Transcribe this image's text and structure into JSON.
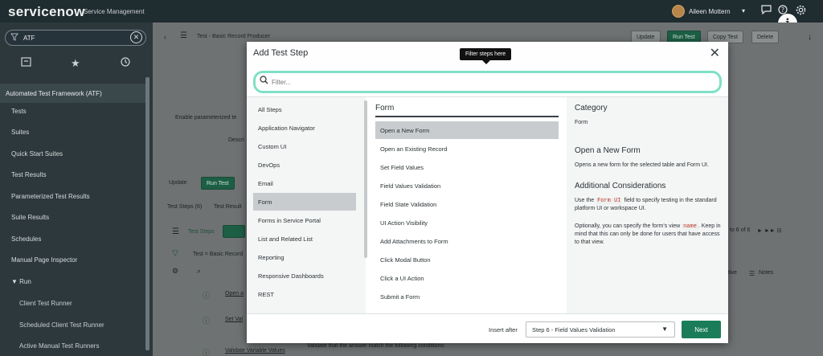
{
  "topbar": {
    "logo": "servicenow",
    "logo_sub": "Service Management",
    "user_name": "Aileen Mottern",
    "caret": "▾",
    "chat_icon": "chat-icon",
    "help_icon": "help-icon",
    "settings_icon": "gear-icon",
    "info_badge": "i"
  },
  "sidebar": {
    "filter_value": "ATF",
    "tabs": [
      "all-apps-icon",
      "star-icon",
      "history-icon"
    ],
    "module_title": "Automated Test Framework (ATF)",
    "items": [
      "Tests",
      "Suites",
      "Quick Start Suites",
      "Test Results",
      "Parameterized Test Results",
      "Suite Results",
      "Schedules",
      "Manual Page Inspector",
      "▼ Run"
    ],
    "sub_items": [
      "Client Test Runner",
      "Scheduled Client Test Runner",
      "Active Manual Test Runners"
    ]
  },
  "page": {
    "breadcrumb": "Test - Basic Record Producer",
    "header_buttons": [
      "Update",
      "Run Test",
      "Copy Test",
      "Delete"
    ],
    "form_labels": [
      "Enable parameterized te",
      "Descri"
    ],
    "action_buttons": [
      "Update",
      "Run Test"
    ],
    "related_tabs": [
      "Test Steps (6)",
      "Test Result"
    ],
    "list_title": "Test Steps",
    "list_filter": "Test = Basic Record",
    "pager": "to 6 of 6",
    "col_headers": [
      "tive",
      "Notes"
    ],
    "row_links": [
      "Open a",
      "Set Val",
      "Validate Variable Values"
    ],
    "row_text": "Validate that the answer match the following conditions:"
  },
  "modal": {
    "title": "Add Test Step",
    "tooltip": "Filter steps here",
    "search_placeholder": "Filter...",
    "categories": [
      "All Steps",
      "Application Navigator",
      "Custom UI",
      "DevOps",
      "Email",
      "Form",
      "Forms in Service Portal",
      "List and Related List",
      "Reporting",
      "Responsive Dashboards",
      "REST"
    ],
    "selected_category": "Form",
    "steps_heading": "Form",
    "steps": [
      "Open a New Form",
      "Open an Existing Record",
      "Set Field Values",
      "Field Values Validation",
      "Field State Validation",
      "UI Action Visibility",
      "Add Attachments to Form",
      "Click Modal Button",
      "Click a UI Action",
      "Submit a Form"
    ],
    "selected_step": "Open a New Form",
    "detail": {
      "category_label": "Category",
      "category_value": "Form",
      "step_title": "Open a New Form",
      "step_desc": "Opens a new form for the selected table and Form UI.",
      "considerations_title": "Additional Considerations",
      "c1_pre": "Use the",
      "c1_code": "Form UI",
      "c1_post": "field to specify testing in the standard platform UI or workspace UI.",
      "c2_pre": "Optionally, you can specify the form's view",
      "c2_code": "name",
      "c2_post": ". Keep in mind that this can only be done for users that have access to that view."
    },
    "footer": {
      "insert_after_label": "Insert after",
      "insert_after_value": "Step 6 - Field Values Validation",
      "next_label": "Next"
    }
  },
  "colors": {
    "accent_green": "#1b7c5a",
    "focus_ring": "#7fe0c6",
    "nav_bg": "#2c383c",
    "banner_bg": "#1f2c30"
  }
}
